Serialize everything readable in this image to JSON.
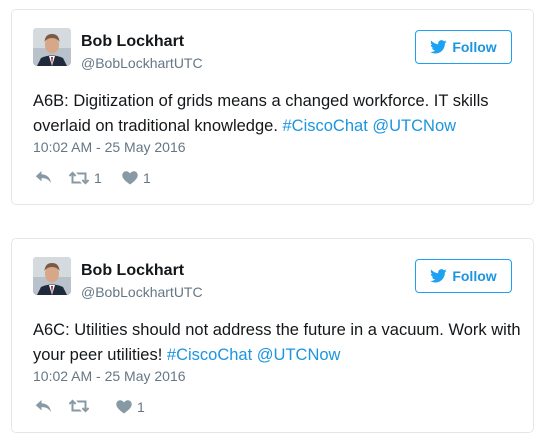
{
  "colors": {
    "link": "#1b95e0",
    "follow_border": "#1da1f2",
    "meta_text": "#657786",
    "action_icon": "#8899a6",
    "card_border": "#e1e8ed"
  },
  "tweets": [
    {
      "author_name": "Bob Lockhart",
      "handle": "@BobLockhartUTC",
      "follow_label": "Follow",
      "follow_icon": "twitter-bird-icon",
      "text_main": "A6B: Digitization of grids means a changed workforce. IT skills overlaid on traditional knowledge.",
      "hashtag": "#CiscoChat",
      "mention": "@UTCNow",
      "timestamp": "10:02 AM - 25 May 2016",
      "reply_icon": "reply-icon",
      "retweet_icon": "retweet-icon",
      "retweet_count": "1",
      "like_icon": "heart-icon",
      "like_count": "1"
    },
    {
      "author_name": "Bob Lockhart",
      "handle": "@BobLockhartUTC",
      "follow_label": "Follow",
      "follow_icon": "twitter-bird-icon",
      "text_main": "A6C: Utilities should not address the future in a vacuum. Work with your peer utilities!",
      "hashtag": "#CiscoChat",
      "mention": "@UTCNow",
      "timestamp": "10:02 AM - 25 May 2016",
      "reply_icon": "reply-icon",
      "retweet_icon": "retweet-icon",
      "retweet_count": "",
      "like_icon": "heart-icon",
      "like_count": "1"
    }
  ]
}
